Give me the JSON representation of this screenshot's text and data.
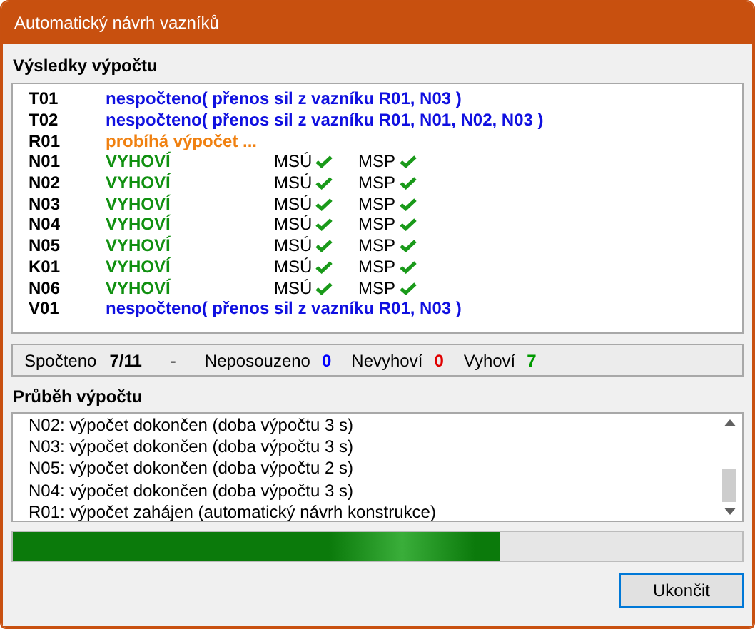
{
  "window": {
    "title": "Automatický návrh vazníků"
  },
  "results": {
    "heading": "Výsledky výpočtu",
    "rows": [
      {
        "id": "T01",
        "kind": "pending",
        "status": "nespočteno( přenos sil z vazníku R01, N03 )"
      },
      {
        "id": "T02",
        "kind": "pending",
        "status": "nespočteno( přenos sil z vazníku R01, N01, N02, N03 )"
      },
      {
        "id": "R01",
        "kind": "running",
        "status": "probíhá výpočet ..."
      },
      {
        "id": "N01",
        "kind": "pass",
        "status": "VYHOVÍ",
        "checks": [
          {
            "label": "MSÚ",
            "ok": true
          },
          {
            "label": "MSP",
            "ok": true
          }
        ]
      },
      {
        "id": "N02",
        "kind": "pass",
        "status": "VYHOVÍ",
        "checks": [
          {
            "label": "MSÚ",
            "ok": true
          },
          {
            "label": "MSP",
            "ok": true
          }
        ]
      },
      {
        "id": "N03",
        "kind": "pass",
        "status": "VYHOVÍ",
        "checks": [
          {
            "label": "MSÚ",
            "ok": true
          },
          {
            "label": "MSP",
            "ok": true
          }
        ]
      },
      {
        "id": "N04",
        "kind": "pass",
        "status": "VYHOVÍ",
        "checks": [
          {
            "label": "MSÚ",
            "ok": true
          },
          {
            "label": "MSP",
            "ok": true
          }
        ]
      },
      {
        "id": "N05",
        "kind": "pass",
        "status": "VYHOVÍ",
        "checks": [
          {
            "label": "MSÚ",
            "ok": true
          },
          {
            "label": "MSP",
            "ok": true
          }
        ]
      },
      {
        "id": "K01",
        "kind": "pass",
        "status": "VYHOVÍ",
        "checks": [
          {
            "label": "MSÚ",
            "ok": true
          },
          {
            "label": "MSP",
            "ok": true
          }
        ]
      },
      {
        "id": "N06",
        "kind": "pass",
        "status": "VYHOVÍ",
        "checks": [
          {
            "label": "MSÚ",
            "ok": true
          },
          {
            "label": "MSP",
            "ok": true
          }
        ]
      },
      {
        "id": "V01",
        "kind": "pending",
        "status": "nespočteno( přenos sil z vazníku R01, N03 )"
      }
    ]
  },
  "summary": {
    "computed_label": "Spočteno",
    "computed_value": "7/11",
    "separator": "-",
    "counts": [
      {
        "label": "Neposouzeno",
        "value": "0",
        "color": "#0000ff"
      },
      {
        "label": "Nevyhoví",
        "value": "0",
        "color": "#e00000"
      },
      {
        "label": "Vyhoví",
        "value": "7",
        "color": "#009900"
      }
    ]
  },
  "log": {
    "heading": "Průběh výpočtu",
    "lines": [
      "N02: výpočet dokončen (doba výpočtu 3 s)",
      "N03: výpočet dokončen (doba výpočtu 3 s)",
      "N05: výpočet dokončen (doba výpočtu 2 s)",
      "N04: výpočet dokončen (doba výpočtu 3 s)",
      "R01: výpočet zahájen (automatický návrh konstrukce)"
    ]
  },
  "progress": {
    "level": 0.667
  },
  "buttons": [
    "Ukončit"
  ]
}
